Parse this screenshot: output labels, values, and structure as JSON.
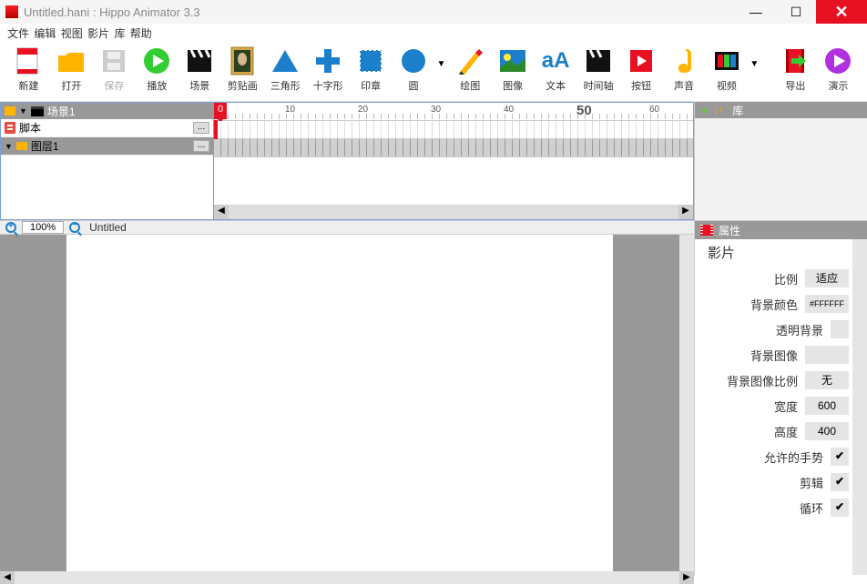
{
  "window": {
    "title": "Untitled.hani : Hippo Animator 3.3"
  },
  "menu": {
    "file": "文件",
    "edit": "编辑",
    "view": "视图",
    "movie": "影片",
    "library": "库",
    "help": "帮助"
  },
  "tools": {
    "new": "新建",
    "open": "打开",
    "save": "保存",
    "play": "播放",
    "scene": "场景",
    "clipart": "剪贴画",
    "triangle": "三角形",
    "cross": "十字形",
    "stamp": "印章",
    "circle": "圆",
    "draw": "绘图",
    "image": "图像",
    "text": "文本",
    "timeline": "时间轴",
    "button": "按钮",
    "sound": "声音",
    "video": "视频",
    "export": "导出",
    "demo": "演示"
  },
  "layers": {
    "scene": "场景1",
    "script": "脚本",
    "layer1": "图层1"
  },
  "timeline": {
    "current": "0",
    "ticks": [
      "10",
      "20",
      "30",
      "40",
      "50",
      "60"
    ]
  },
  "library": {
    "title": "库"
  },
  "canvas": {
    "zoom": "100%",
    "doc": "Untitled"
  },
  "properties": {
    "title": "属性",
    "section": "影片",
    "scale_lbl": "比例",
    "scale_val": "适应",
    "bgcolor_lbl": "背景颜色",
    "bgcolor_val": "#FFFFFF",
    "transbg_lbl": "透明背景",
    "bgimg_lbl": "背景图像",
    "bgimgscale_lbl": "背景图像比例",
    "bgimgscale_val": "无",
    "width_lbl": "宽度",
    "width_val": "600",
    "height_lbl": "高度",
    "height_val": "400",
    "gesture_lbl": "允许的手势",
    "gesture_val": "✔",
    "clip_lbl": "剪辑",
    "clip_val": "✔",
    "loop_lbl": "循环",
    "loop_val": "✔"
  }
}
